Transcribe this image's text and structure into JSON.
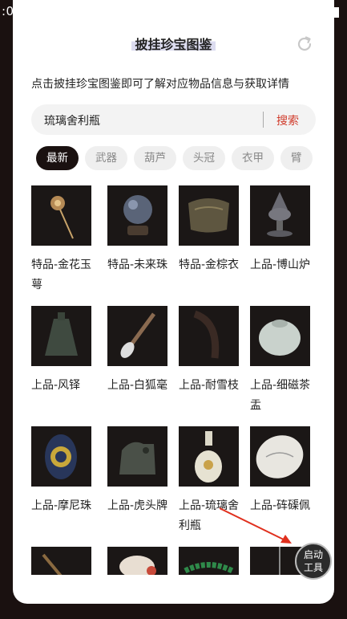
{
  "status": {
    "time": ":00"
  },
  "header": {
    "title": "披挂珍宝图鉴"
  },
  "description": "点击披挂珍宝图鉴即可了解对应物品信息与获取详情",
  "search": {
    "value": "琉璃舍利瓶",
    "button": "搜索"
  },
  "tabs": [
    {
      "label": "最新",
      "active": true
    },
    {
      "label": "武器",
      "active": false
    },
    {
      "label": "葫芦",
      "active": false
    },
    {
      "label": "头冠",
      "active": false
    },
    {
      "label": "衣甲",
      "active": false
    },
    {
      "label": "臂",
      "active": false
    }
  ],
  "items": [
    {
      "label": "特品-金花玉萼"
    },
    {
      "label": "特品-未来珠"
    },
    {
      "label": "特品-金棕衣"
    },
    {
      "label": "上品-博山炉"
    },
    {
      "label": "上品-风铎"
    },
    {
      "label": "上品-白狐毫"
    },
    {
      "label": "上品-耐雪枝"
    },
    {
      "label": "上品-细磁茶盂"
    },
    {
      "label": "上品-摩尼珠"
    },
    {
      "label": "上品-虎头牌"
    },
    {
      "label": "上品-琉璃舍利瓶"
    },
    {
      "label": "上品-砗磲佩"
    },
    {
      "label": ""
    },
    {
      "label": ""
    },
    {
      "label": ""
    },
    {
      "label": ""
    }
  ],
  "fab": {
    "line1": "启动",
    "line2": "工具"
  },
  "colors": {
    "accent": "#d03a2a",
    "dark": "#1a1110"
  }
}
